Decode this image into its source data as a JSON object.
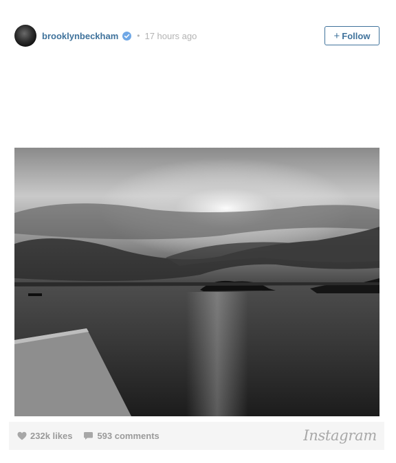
{
  "post": {
    "username": "brooklynbeckham",
    "separator": "•",
    "time_ago": "17 hours ago",
    "follow_label": "Follow"
  },
  "photo": {
    "colors": [
      "#ffffff",
      "#000000"
    ]
  },
  "stats": {
    "likes": "232k likes",
    "comments": "593 comments"
  },
  "brand": {
    "wordmark": "Instagram"
  },
  "colors": {
    "link": "#3f729b",
    "muted": "#b3b3b3",
    "footer_bg": "#f5f5f5"
  }
}
